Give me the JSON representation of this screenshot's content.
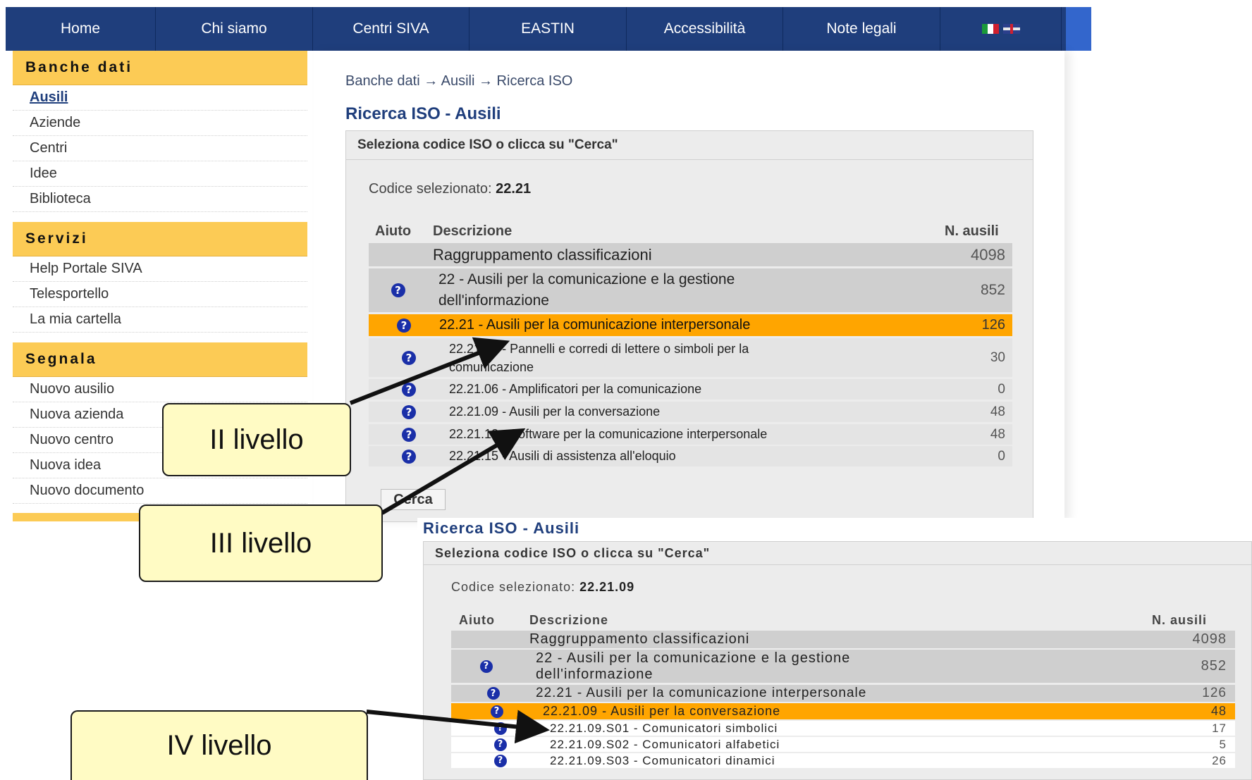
{
  "nav": {
    "items": [
      "Home",
      "Chi siamo",
      "Centri SIVA",
      "EASTIN",
      "Accessibilità",
      "Note legali"
    ],
    "flags": [
      "flag-italy-icon",
      "flag-uk-icon"
    ]
  },
  "sidebar": {
    "banche_header": "Banche dati",
    "banche_items": [
      "Ausili",
      "Aziende",
      "Centri",
      "Idee",
      "Biblioteca"
    ],
    "servizi_header": "Servizi",
    "servizi_items": [
      "Help Portale SIVA",
      "Telesportello",
      "La mia cartella"
    ],
    "segnala_header": "Segnala",
    "segnala_items": [
      "Nuovo ausilio",
      "Nuova azienda",
      "Nuovo centro",
      "Nuova idea",
      "Nuovo documento"
    ]
  },
  "main": {
    "breadcrumb": "Banche dati → Ausili → Ricerca ISO",
    "title": "Ricerca ISO - Ausili",
    "panel_header": "Seleziona codice ISO o clicca su \"Cerca\"",
    "selected_label": "Codice selezionato:",
    "selected_code": "22.21",
    "col_help": "Aiuto",
    "col_desc": "Descrizione",
    "col_count": "N. ausili",
    "rows": [
      {
        "desc": "Raggruppamento classificazioni",
        "count": "4098"
      },
      {
        "desc": "22 - Ausili per la comunicazione e la gestione dell'informazione",
        "count": "852"
      },
      {
        "desc": "22.21 - Ausili per la comunicazione interpersonale",
        "count": "126"
      },
      {
        "desc": "22.21.03 - Pannelli e corredi di lettere o simboli per la comunicazione",
        "count": "30"
      },
      {
        "desc": "22.21.06 - Amplificatori per la comunicazione",
        "count": "0"
      },
      {
        "desc": "22.21.09 - Ausili per la conversazione",
        "count": "48"
      },
      {
        "desc": "22.21.12 - Software per la comunicazione interpersonale",
        "count": "48"
      },
      {
        "desc": "22.21.15 - Ausili di assistenza all'eloquio",
        "count": "0"
      }
    ],
    "search_button": "Cerca"
  },
  "second": {
    "title": "Ricerca ISO - Ausili",
    "panel_header": "Seleziona codice ISO o clicca su \"Cerca\"",
    "selected_label": "Codice selezionato:",
    "selected_code": "22.21.09",
    "col_help": "Aiuto",
    "col_desc": "Descrizione",
    "col_count": "N. ausili",
    "rows": [
      {
        "desc": "Raggruppamento classificazioni",
        "count": "4098"
      },
      {
        "desc": "22 - Ausili per la comunicazione e la gestione dell'informazione",
        "count": "852"
      },
      {
        "desc": "22.21 - Ausili per la comunicazione interpersonale",
        "count": "126"
      },
      {
        "desc": "22.21.09 - Ausili per la conversazione",
        "count": "48"
      },
      {
        "desc": "22.21.09.S01 - Comunicatori simbolici",
        "count": "17"
      },
      {
        "desc": "22.21.09.S02 - Comunicatori alfabetici",
        "count": "5"
      },
      {
        "desc": "22.21.09.S03 - Comunicatori dinamici",
        "count": "26"
      }
    ]
  },
  "callouts": {
    "level2": "II livello",
    "level3": "III livello",
    "level4": "IV livello"
  },
  "colors": {
    "nav_bg": "#1f3e7c",
    "sidebar_header": "#fccb55",
    "highlight": "#ffa500",
    "callout_bg": "#fffbc4",
    "help_icon": "#1a2fa8"
  },
  "help_icon": "help-question-icon"
}
